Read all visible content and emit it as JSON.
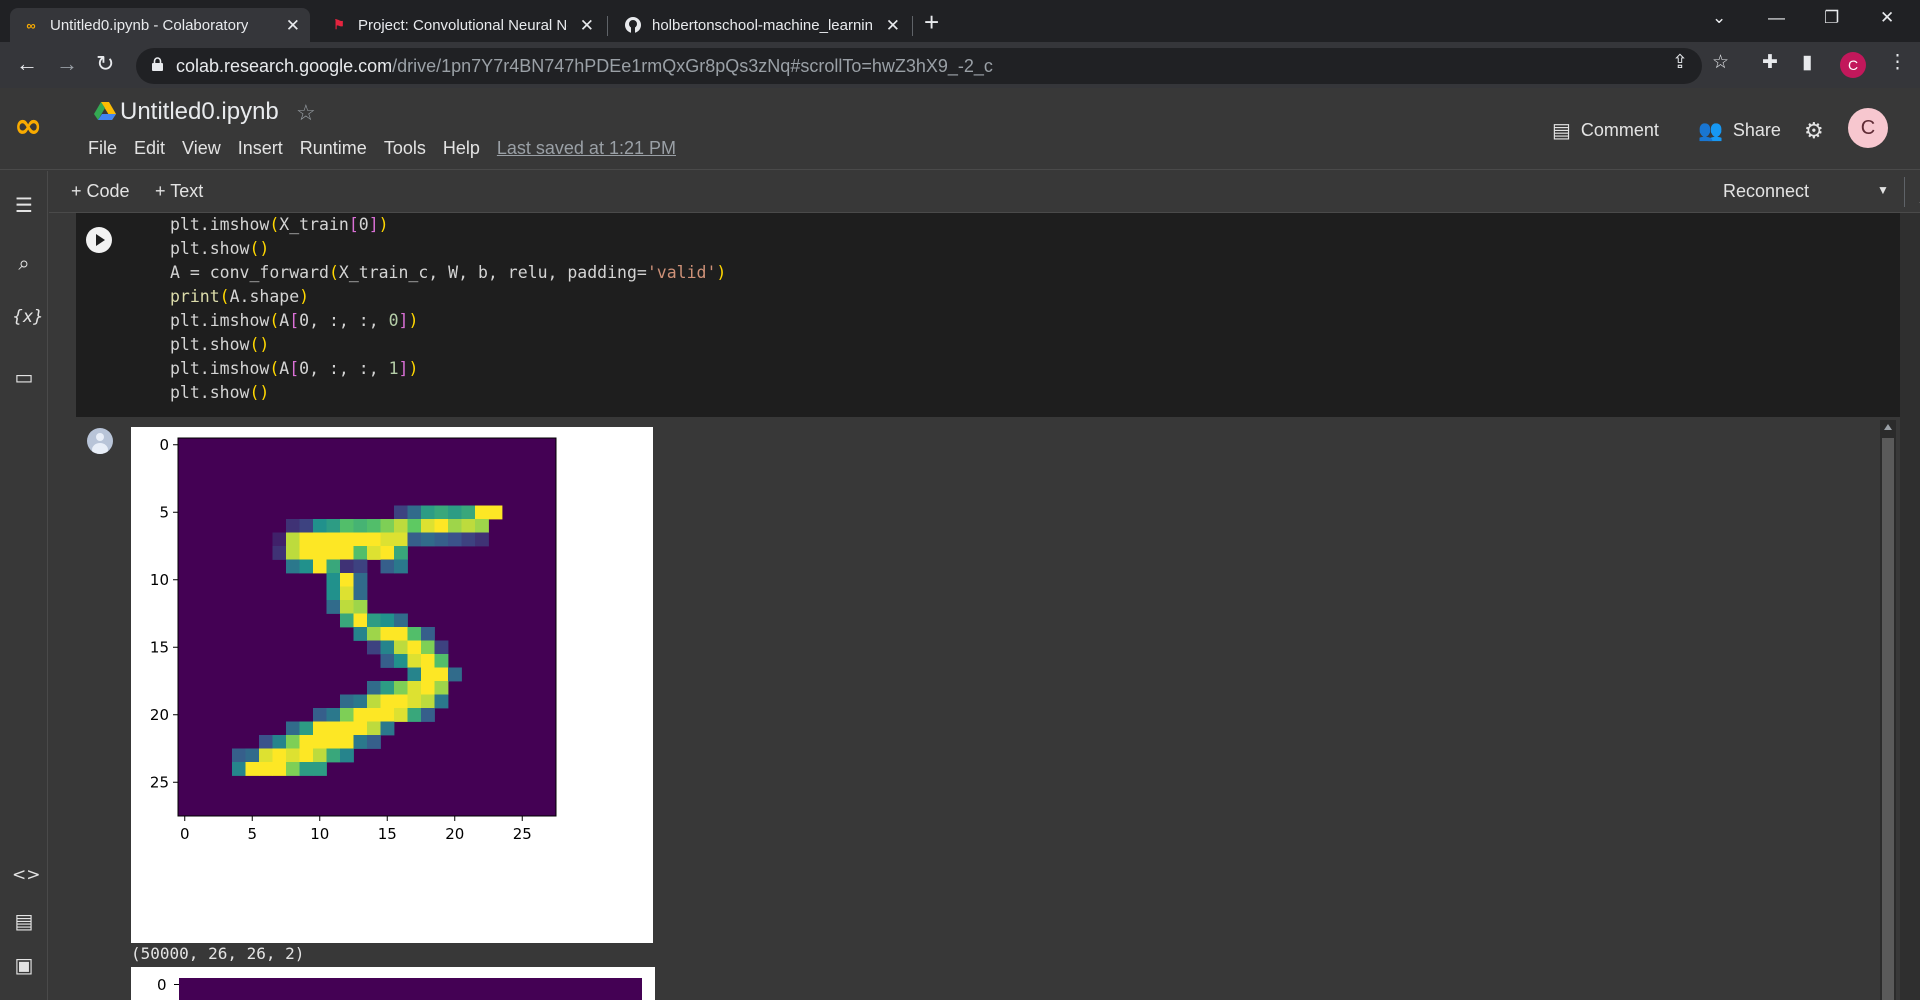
{
  "browser": {
    "tabs": [
      {
        "title": "Untitled0.ipynb - Colaboratory",
        "favicon": "colab-icon"
      },
      {
        "title": "Project: Convolutional Neural Ne",
        "favicon": "holberton-icon"
      },
      {
        "title": "holbertonschool-machine_learnin",
        "favicon": "github-icon"
      }
    ],
    "url_host": "colab.research.google.com",
    "url_path": "/drive/1pn7Y7r4BN747hPDEe1rmQxGr8pQs3zNq#scrollTo=hwZ3hX9_-2_c",
    "profile_initial": "C"
  },
  "colab": {
    "logo": "CO",
    "notebook_title": "Untitled0.ipynb",
    "menu": [
      "File",
      "Edit",
      "View",
      "Insert",
      "Runtime",
      "Tools",
      "Help"
    ],
    "last_saved": "Last saved at 1:21 PM",
    "comment_label": "Comment",
    "share_label": "Share",
    "avatar_initial": "C"
  },
  "toolbar": {
    "add_code": "+ Code",
    "add_text": "+ Text",
    "reconnect": "Reconnect"
  },
  "cell": {
    "lines": [
      "plt.imshow(X_train[0])",
      "plt.show()",
      "A = conv_forward(X_train_c, W, b, relu, padding='valid')",
      "print(A.shape)",
      "plt.imshow(A[0, :, :, 0])",
      "plt.show()",
      "plt.imshow(A[0, :, :, 1])",
      "plt.show()"
    ]
  },
  "output": {
    "stdout": "(50000, 26, 26, 2)",
    "second_plot_first_ytick": "0"
  },
  "chart_data": {
    "type": "heatmap",
    "title": "",
    "xlabel": "",
    "ylabel": "",
    "colormap": "viridis",
    "shape": [
      28,
      28
    ],
    "xticks": [
      0,
      5,
      10,
      15,
      20,
      25
    ],
    "yticks": [
      0,
      5,
      10,
      15,
      20,
      25
    ],
    "xlim": [
      -0.5,
      27.5
    ],
    "ylim": [
      27.5,
      -0.5
    ],
    "nonzero_pixels": [
      [
        5,
        16,
        0.2
      ],
      [
        5,
        17,
        0.35
      ],
      [
        5,
        18,
        0.55
      ],
      [
        5,
        19,
        0.6
      ],
      [
        5,
        20,
        0.55
      ],
      [
        5,
        21,
        0.6
      ],
      [
        5,
        22,
        1.0
      ],
      [
        5,
        23,
        1.0
      ],
      [
        6,
        8,
        0.15
      ],
      [
        6,
        9,
        0.2
      ],
      [
        6,
        10,
        0.5
      ],
      [
        6,
        11,
        0.55
      ],
      [
        6,
        12,
        0.7
      ],
      [
        6,
        13,
        0.65
      ],
      [
        6,
        14,
        0.7
      ],
      [
        6,
        15,
        0.8
      ],
      [
        6,
        16,
        0.9
      ],
      [
        6,
        17,
        0.75
      ],
      [
        6,
        18,
        0.95
      ],
      [
        6,
        19,
        1.0
      ],
      [
        6,
        20,
        0.85
      ],
      [
        6,
        21,
        0.9
      ],
      [
        6,
        22,
        0.85
      ],
      [
        7,
        7,
        0.1
      ],
      [
        7,
        8,
        0.9
      ],
      [
        7,
        9,
        1.0
      ],
      [
        7,
        10,
        1.0
      ],
      [
        7,
        11,
        1.0
      ],
      [
        7,
        12,
        1.0
      ],
      [
        7,
        13,
        1.0
      ],
      [
        7,
        14,
        1.0
      ],
      [
        7,
        15,
        0.95
      ],
      [
        7,
        16,
        0.95
      ],
      [
        7,
        17,
        0.3
      ],
      [
        7,
        18,
        0.35
      ],
      [
        7,
        19,
        0.3
      ],
      [
        7,
        20,
        0.25
      ],
      [
        7,
        21,
        0.2
      ],
      [
        7,
        22,
        0.15
      ],
      [
        8,
        7,
        0.15
      ],
      [
        8,
        8,
        0.9
      ],
      [
        8,
        9,
        1.0
      ],
      [
        8,
        10,
        1.0
      ],
      [
        8,
        11,
        1.0
      ],
      [
        8,
        12,
        1.0
      ],
      [
        8,
        13,
        0.7
      ],
      [
        8,
        14,
        0.95
      ],
      [
        8,
        15,
        1.0
      ],
      [
        8,
        16,
        0.6
      ],
      [
        9,
        8,
        0.4
      ],
      [
        9,
        9,
        0.5
      ],
      [
        9,
        10,
        1.0
      ],
      [
        9,
        11,
        0.6
      ],
      [
        9,
        12,
        0.15
      ],
      [
        9,
        13,
        0.2
      ],
      [
        9,
        15,
        0.3
      ],
      [
        9,
        16,
        0.4
      ],
      [
        10,
        11,
        0.5
      ],
      [
        10,
        12,
        1.0
      ],
      [
        10,
        13,
        0.35
      ],
      [
        11,
        11,
        0.5
      ],
      [
        11,
        12,
        0.95
      ],
      [
        11,
        13,
        0.35
      ],
      [
        12,
        11,
        0.35
      ],
      [
        12,
        12,
        0.9
      ],
      [
        12,
        13,
        0.85
      ],
      [
        13,
        12,
        0.6
      ],
      [
        13,
        13,
        1.0
      ],
      [
        13,
        14,
        0.55
      ],
      [
        13,
        15,
        0.5
      ],
      [
        13,
        16,
        0.35
      ],
      [
        14,
        13,
        0.45
      ],
      [
        14,
        14,
        0.85
      ],
      [
        14,
        15,
        1.0
      ],
      [
        14,
        16,
        1.0
      ],
      [
        14,
        17,
        0.7
      ],
      [
        14,
        18,
        0.3
      ],
      [
        15,
        14,
        0.2
      ],
      [
        15,
        15,
        0.45
      ],
      [
        15,
        16,
        0.9
      ],
      [
        15,
        17,
        1.0
      ],
      [
        15,
        18,
        0.8
      ],
      [
        15,
        19,
        0.2
      ],
      [
        16,
        15,
        0.3
      ],
      [
        16,
        16,
        0.5
      ],
      [
        16,
        17,
        0.95
      ],
      [
        16,
        18,
        1.0
      ],
      [
        16,
        19,
        0.7
      ],
      [
        17,
        17,
        0.45
      ],
      [
        17,
        18,
        1.0
      ],
      [
        17,
        19,
        1.0
      ],
      [
        17,
        20,
        0.35
      ],
      [
        18,
        14,
        0.35
      ],
      [
        18,
        15,
        0.55
      ],
      [
        18,
        16,
        0.8
      ],
      [
        18,
        17,
        0.95
      ],
      [
        18,
        18,
        1.0
      ],
      [
        18,
        19,
        0.85
      ],
      [
        19,
        12,
        0.35
      ],
      [
        19,
        13,
        0.4
      ],
      [
        19,
        14,
        0.9
      ],
      [
        19,
        15,
        1.0
      ],
      [
        19,
        16,
        1.0
      ],
      [
        19,
        17,
        0.95
      ],
      [
        19,
        18,
        0.9
      ],
      [
        19,
        19,
        0.4
      ],
      [
        20,
        10,
        0.3
      ],
      [
        20,
        11,
        0.4
      ],
      [
        20,
        12,
        0.8
      ],
      [
        20,
        13,
        1.0
      ],
      [
        20,
        14,
        1.0
      ],
      [
        20,
        15,
        1.0
      ],
      [
        20,
        16,
        0.95
      ],
      [
        20,
        17,
        0.6
      ],
      [
        20,
        18,
        0.3
      ],
      [
        21,
        8,
        0.35
      ],
      [
        21,
        9,
        0.55
      ],
      [
        21,
        10,
        1.0
      ],
      [
        21,
        11,
        1.0
      ],
      [
        21,
        12,
        1.0
      ],
      [
        21,
        13,
        1.0
      ],
      [
        21,
        14,
        0.9
      ],
      [
        21,
        15,
        0.4
      ],
      [
        22,
        6,
        0.25
      ],
      [
        22,
        7,
        0.45
      ],
      [
        22,
        8,
        0.8
      ],
      [
        22,
        9,
        1.0
      ],
      [
        22,
        10,
        1.0
      ],
      [
        22,
        11,
        1.0
      ],
      [
        22,
        12,
        1.0
      ],
      [
        22,
        13,
        0.4
      ],
      [
        22,
        14,
        0.3
      ],
      [
        23,
        4,
        0.3
      ],
      [
        23,
        5,
        0.35
      ],
      [
        23,
        6,
        0.95
      ],
      [
        23,
        7,
        1.0
      ],
      [
        23,
        8,
        0.95
      ],
      [
        23,
        9,
        1.0
      ],
      [
        23,
        10,
        0.9
      ],
      [
        23,
        11,
        0.6
      ],
      [
        23,
        12,
        0.45
      ],
      [
        24,
        4,
        0.45
      ],
      [
        24,
        5,
        1.0
      ],
      [
        24,
        6,
        1.0
      ],
      [
        24,
        7,
        1.0
      ],
      [
        24,
        8,
        0.8
      ],
      [
        24,
        9,
        0.55
      ],
      [
        24,
        10,
        0.55
      ]
    ]
  }
}
